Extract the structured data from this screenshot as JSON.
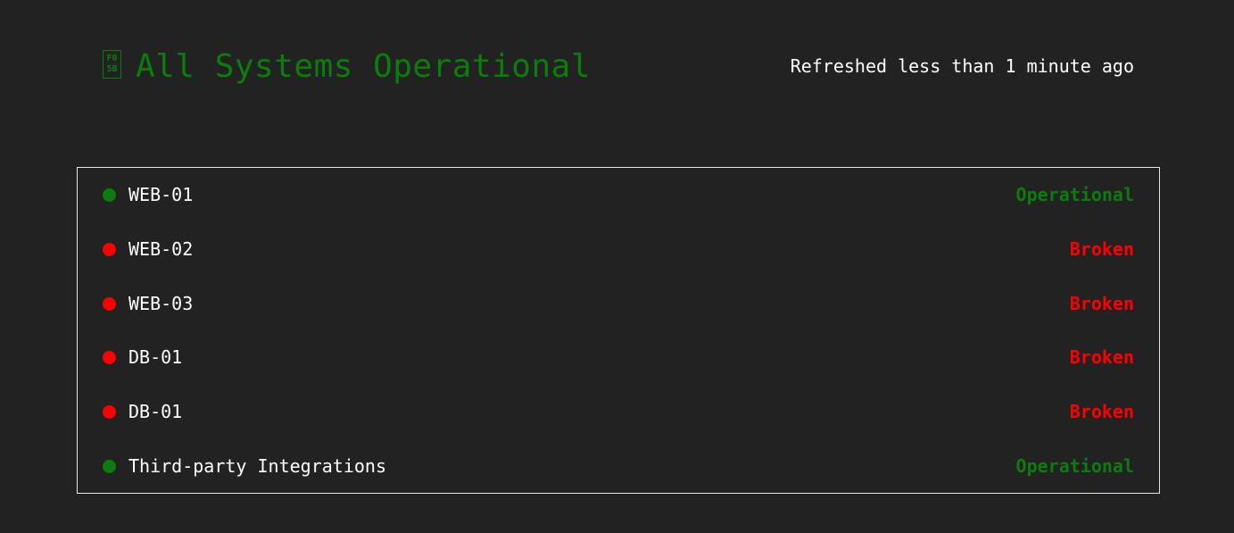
{
  "header": {
    "icon_glyph_top": "F0",
    "icon_glyph_bottom": "5B",
    "title": "All Systems Operational",
    "refreshed": "Refreshed less than 1 minute ago"
  },
  "colors": {
    "operational": "#0b7d0b",
    "broken": "#ff0000",
    "background": "#222222"
  },
  "services": [
    {
      "name": "WEB-01",
      "status": "Operational",
      "state": "ok"
    },
    {
      "name": "WEB-02",
      "status": "Broken",
      "state": "bad"
    },
    {
      "name": "WEB-03",
      "status": "Broken",
      "state": "bad"
    },
    {
      "name": "DB-01",
      "status": "Broken",
      "state": "bad"
    },
    {
      "name": "DB-01",
      "status": "Broken",
      "state": "bad"
    },
    {
      "name": "Third-party Integrations",
      "status": "Operational",
      "state": "ok"
    }
  ]
}
